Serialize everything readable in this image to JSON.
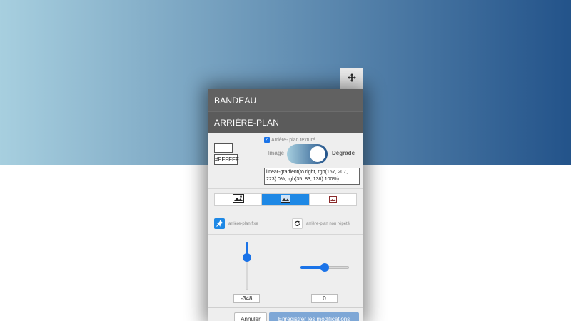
{
  "colors": {
    "gradient_start": "#a7cfdf",
    "gradient_end": "#23538a",
    "accent": "#1e88e5",
    "header_bg": "#616161"
  },
  "panel": {
    "section_banner": "BANDEAU",
    "section_background": "ARRIÈRE-PLAN",
    "color_value": "#FFFFFF",
    "textured_checkbox": {
      "label": "Arrière- plan texturé",
      "checked": true
    },
    "toggle": {
      "left_label": "Image",
      "right_label": "Dégradé",
      "state": "Dégradé"
    },
    "gradient_css": "linear-gradient(to right, rgb(167, 207, 223) 0%, rgb(35, 83, 138) 100%)",
    "type_buttons": [
      {
        "icon": "image-icon",
        "active": false
      },
      {
        "icon": "image-stretch-icon",
        "active": true
      },
      {
        "icon": "image-small-icon",
        "active": false
      }
    ],
    "fixed_bg_label": "arrière-plan fixe",
    "no_repeat_label": "arrière-plan non répété",
    "vertical_value": "-348",
    "horizontal_value": "0",
    "cancel_label": "Annuler",
    "save_label": "Enregistrer les modifications"
  }
}
